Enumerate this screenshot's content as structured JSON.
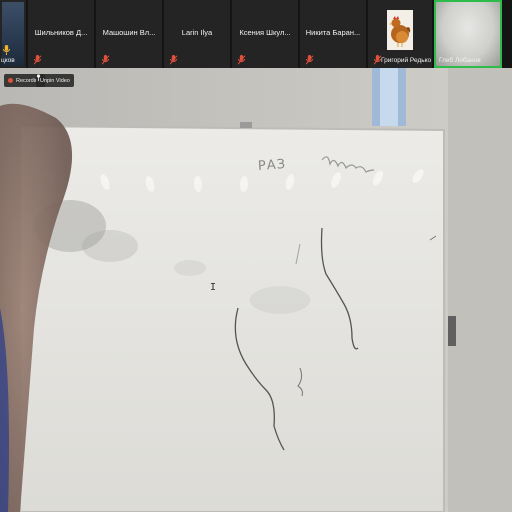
{
  "participants": [
    {
      "id": "p0",
      "name": "",
      "bottom_name": "цков",
      "muted": false,
      "type": "partial-cam"
    },
    {
      "id": "p1",
      "name": "Шильников Д...",
      "bottom_name": "",
      "muted": true,
      "type": "name"
    },
    {
      "id": "p2",
      "name": "Машошин Вл...",
      "bottom_name": "",
      "muted": true,
      "type": "name"
    },
    {
      "id": "p3",
      "name": "Larin Ilya",
      "bottom_name": "",
      "muted": true,
      "type": "name"
    },
    {
      "id": "p4",
      "name": "Ксения Шкул...",
      "bottom_name": "",
      "muted": true,
      "type": "name"
    },
    {
      "id": "p5",
      "name": "Никита Баран...",
      "bottom_name": "",
      "muted": true,
      "type": "name"
    },
    {
      "id": "p6",
      "name": "",
      "bottom_name": "Григорий Редько",
      "muted": true,
      "type": "photo"
    },
    {
      "id": "p7",
      "name": "",
      "bottom_name": "Глеб Лобанов",
      "muted": false,
      "type": "cam",
      "active": true
    }
  ],
  "recording": {
    "label": "Recording",
    "dot_color": "#e0513b"
  },
  "unpin": {
    "label": "Unpin Video"
  },
  "whiteboard": {
    "text": [
      "РАЗ"
    ]
  },
  "colors": {
    "active_outline": "#2dbb4a",
    "mute_icon": "#e0513b",
    "tile_bg": "#242424"
  }
}
